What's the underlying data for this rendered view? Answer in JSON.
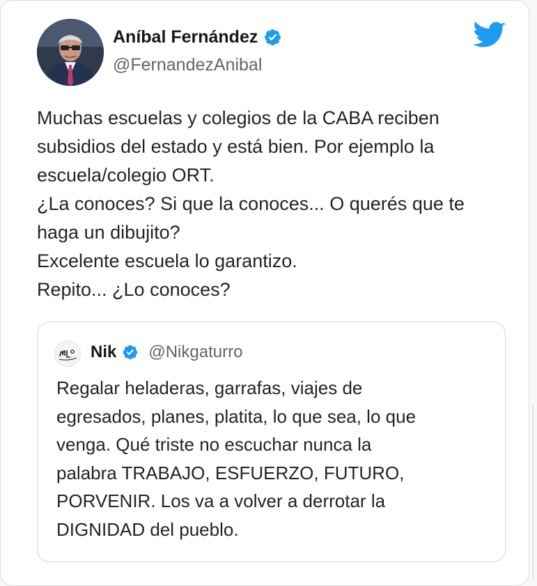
{
  "colors": {
    "accent": "#1d9bf0",
    "text_primary": "#1f2326",
    "text_secondary": "#5c6670",
    "border": "#cfd5da"
  },
  "tweet": {
    "author_name": "Aníbal Fernández",
    "author_handle": "@FernandezAnibal",
    "verified_icon": "verified-badge-icon",
    "platform_icon": "twitter-bird-icon",
    "body_lines": [
      "Muchas escuelas y colegios de la CABA reciben",
      "subsidios del estado y está bien. Por ejemplo la",
      "escuela/colegio ORT.",
      "¿La conoces? Si que la conoces... O querés que te",
      "haga un dibujito?",
      "Excelente escuela lo garantizo.",
      "Repito... ¿Lo conoces?"
    ]
  },
  "quoted_tweet": {
    "author_name": "Nik",
    "author_handle": "@Nikgaturro",
    "verified_icon": "verified-badge-icon",
    "body_lines": [
      "Regalar heladeras, garrafas, viajes de",
      "egresados, planes, platita, lo que sea, lo que",
      "venga. Qué triste no escuchar nunca la",
      "palabra TRABAJO, ESFUERZO, FUTURO,",
      "PORVENIR. Los va a volver a derrotar la",
      "DIGNIDAD del pueblo."
    ]
  }
}
